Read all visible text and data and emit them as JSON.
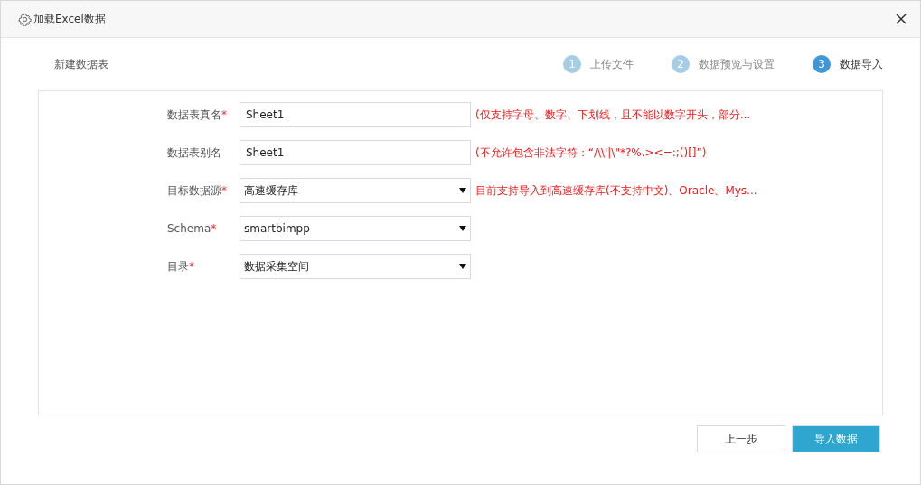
{
  "window": {
    "title": "加载Excel数据"
  },
  "section_title": "新建数据表",
  "steps": [
    {
      "number": "1",
      "label": "上传文件",
      "selected": false
    },
    {
      "number": "2",
      "label": "数据预览与设置",
      "selected": false
    },
    {
      "number": "3",
      "label": "数据导入",
      "selected": true
    }
  ],
  "fields": [
    {
      "kind": "text",
      "label": "数据表真名",
      "required_mark": "*",
      "value": "Sheet1",
      "hint": "(仅支持字母、数字、下划线，且不能以数字开头，部分..."
    },
    {
      "kind": "text",
      "label": "数据表别名",
      "value": "Sheet1",
      "hint": "(不允许包含非法字符：“/\\\\'|\\\"*?%.><=:;()[]”)"
    },
    {
      "kind": "select",
      "label": "目标数据源",
      "required_mark": "*",
      "value": "高速缓存库",
      "hint": "目前支持导入到高速缓存库(不支持中文)、Oracle、Mys..."
    },
    {
      "kind": "select",
      "label": "Schema",
      "required_mark": "*",
      "value": "smartbimpp"
    },
    {
      "kind": "select",
      "label": "目录",
      "required_mark": "*",
      "value": "数据采集空间"
    }
  ],
  "buttons": [
    {
      "label": "上一步",
      "kind": "secondary"
    },
    {
      "label": "导入数据",
      "kind": "primary"
    }
  ]
}
